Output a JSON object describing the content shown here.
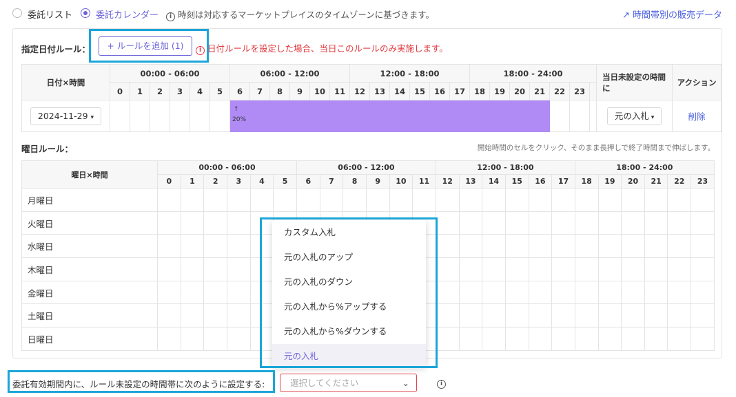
{
  "top": {
    "radio_list_label": "委託リスト",
    "radio_calendar_label": "委託カレンダー",
    "timezone_note": "時刻は対応するマーケットプレイスのタイムゾーンに基づきます。",
    "trend_link": "時間帯別の販売データ"
  },
  "date_rule": {
    "title": "指定日付ルール：",
    "add_button": "+ ルールを追加 (1)",
    "warning": "日付ルールを設定した場合、当日このルールのみ実施します。",
    "header_col": "日付×時間",
    "time_blocks": [
      "00:00 - 06:00",
      "06:00 - 12:00",
      "12:00 - 18:00",
      "18:00 - 24:00"
    ],
    "hours": [
      "0",
      "1",
      "2",
      "3",
      "4",
      "5",
      "6",
      "7",
      "8",
      "9",
      "10",
      "11",
      "12",
      "13",
      "14",
      "15",
      "16",
      "17",
      "18",
      "19",
      "20",
      "21",
      "22",
      "23"
    ],
    "unset_header": "当日未設定の時間に",
    "action_header": "アクション",
    "row": {
      "date": "2024-11-29",
      "active_from_hour": 6,
      "active_to_hour": 22,
      "cell_arrow": "↑",
      "cell_label": "20%",
      "unset_value": "元の入札",
      "delete_label": "削除"
    }
  },
  "weekday_rule": {
    "title": "曜日ルール：",
    "hint": "開始時間のセルをクリック、そのまま長押しで終了時間まで伸ばします。",
    "header_col": "曜日×時間",
    "days": [
      "月曜日",
      "火曜日",
      "水曜日",
      "木曜日",
      "金曜日",
      "土曜日",
      "日曜日"
    ]
  },
  "dropdown": {
    "options": [
      "カスタム入札",
      "元の入札のアップ",
      "元の入札のダウン",
      "元の入札から%アップする",
      "元の入札から%ダウンする",
      "元の入札"
    ],
    "selected_index": 5
  },
  "bottom": {
    "label": "委託有効期間内に、ルール未設定の時間帯に次のように設定する:",
    "select_placeholder": "選択してください"
  },
  "colors": {
    "accent": "#6c63d9",
    "link": "#4a5ee0",
    "warning": "#e0383e",
    "highlight_box": "#1ba5d8",
    "bar_fill": "#b08bf5"
  }
}
